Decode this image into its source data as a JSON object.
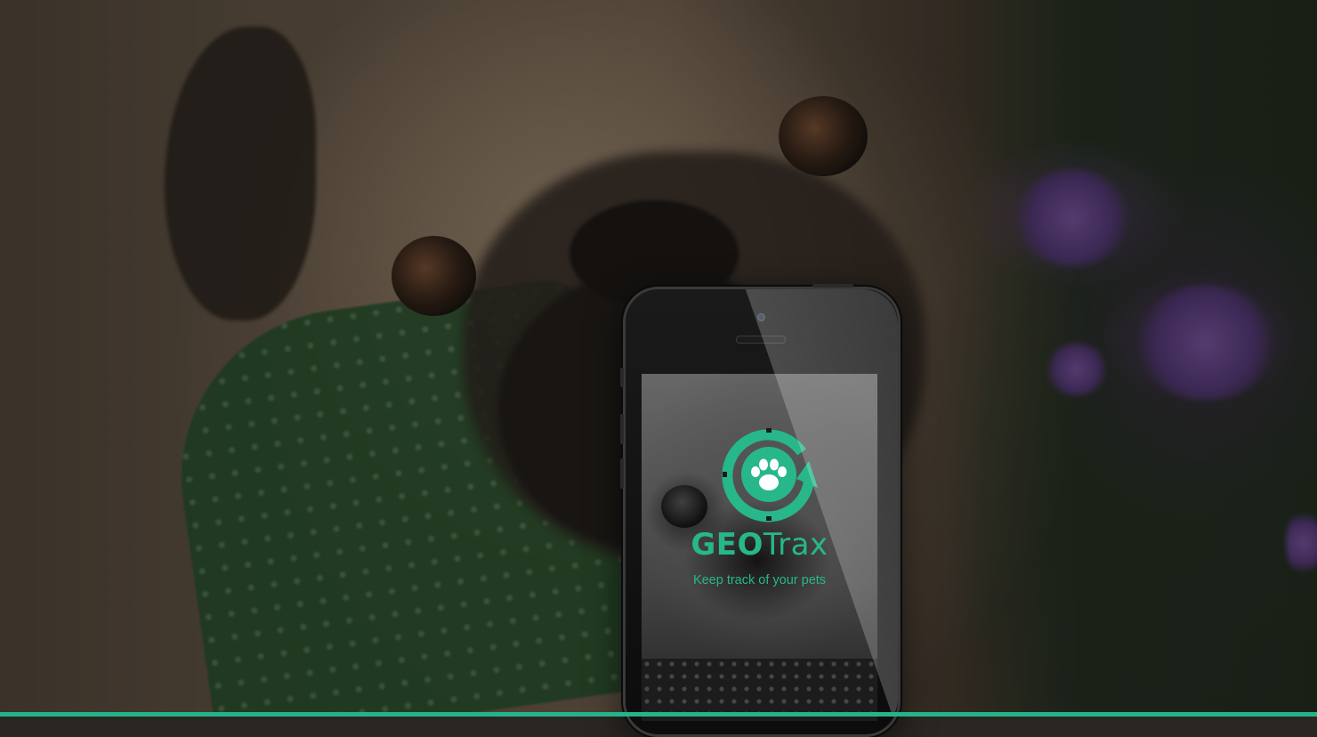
{
  "hero": {
    "brand": {
      "bold": "GEO",
      "regular": "Trax"
    },
    "tagline": "Keep track of your pets",
    "logo_icon": "paw-tracker-icon",
    "accent_color": "#27b78a"
  }
}
